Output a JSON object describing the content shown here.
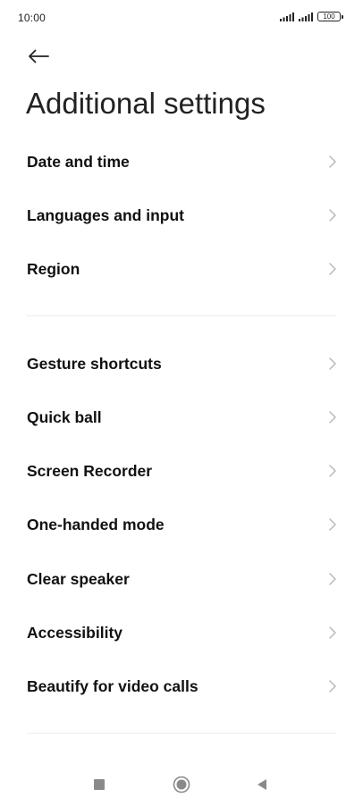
{
  "status_bar": {
    "time": "10:00",
    "battery": "100",
    "signal_icons": [
      "signal-icon",
      "signal-icon"
    ]
  },
  "header": {
    "back_icon": "back-arrow-icon",
    "title": "Additional settings"
  },
  "section_one": {
    "items": [
      {
        "label": "Date and time"
      },
      {
        "label": "Languages and input"
      },
      {
        "label": "Region"
      }
    ]
  },
  "section_two": {
    "items": [
      {
        "label": "Gesture shortcuts"
      },
      {
        "label": "Quick ball"
      },
      {
        "label": "Screen Recorder"
      },
      {
        "label": "One-handed mode"
      },
      {
        "label": "Clear speaker"
      },
      {
        "label": "Accessibility"
      },
      {
        "label": "Beautify for video calls"
      }
    ]
  },
  "nav_bar": {
    "buttons": [
      "recents-square-icon",
      "home-circle-icon",
      "back-triangle-icon"
    ]
  },
  "colors": {
    "text": "#111111",
    "chevron": "#b5b5b5",
    "divider": "#ececec",
    "nav_icon": "#8a8a8a"
  }
}
